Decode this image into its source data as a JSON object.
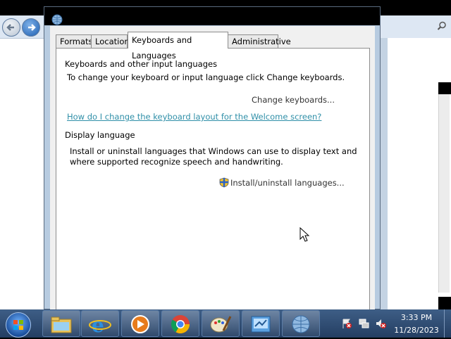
{
  "dialog": {
    "tabs": [
      {
        "label": "Formats"
      },
      {
        "label": "Location"
      },
      {
        "label": "Keyboards and Languages",
        "active": true
      },
      {
        "label": "Administrative"
      }
    ],
    "keyboards_heading": "Keyboards and other input languages",
    "keyboards_desc": "To change your keyboard or input language click Change keyboards.",
    "change_keyboards_button": "Change keyboards...",
    "welcome_link": "How do I change the keyboard layout for the Welcome screen?",
    "display_heading": "Display language",
    "display_desc_line1": "Install or uninstall languages that Windows can use to display text and",
    "display_desc_line2": "where supported recognize speech and handwriting.",
    "install_button": "Install/uninstall languages...",
    "install_icon": "uac-shield-icon"
  },
  "taskbar": {
    "items": [
      {
        "name": "start-orb"
      },
      {
        "name": "explorer"
      },
      {
        "name": "internet-explorer"
      },
      {
        "name": "media-player"
      },
      {
        "name": "chrome"
      },
      {
        "name": "paint"
      },
      {
        "name": "control-panel"
      },
      {
        "name": "region-language"
      }
    ],
    "clock_time": "3:33 PM",
    "clock_date": "11/28/2023"
  },
  "colors": {
    "link": "#2f8fa8",
    "taskbar": "#2d4a70",
    "dialog_frame": "#b7cbe0"
  }
}
